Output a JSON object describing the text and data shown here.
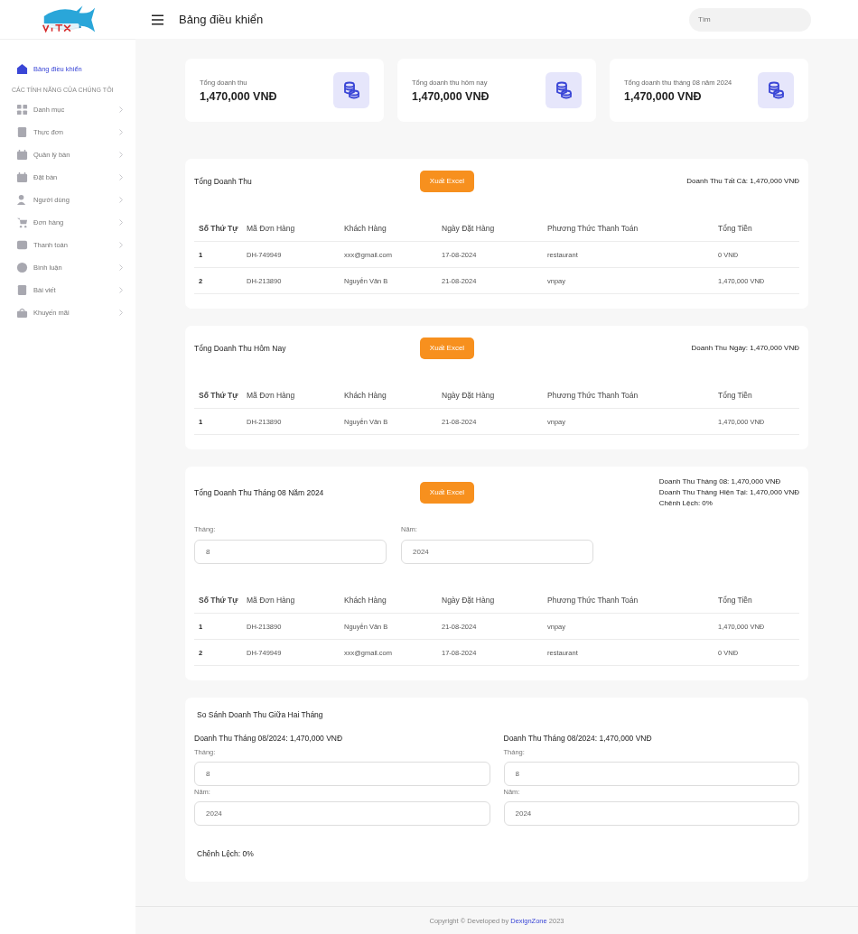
{
  "header": {
    "title": "Bảng điều khiển",
    "search": {
      "placeholder": "Tìm"
    }
  },
  "sidebar": {
    "items": [
      {
        "label": "Bảng điều khiển",
        "selected": true
      }
    ],
    "section_label": "CÁC TÍNH NĂNG CỦA CHÚNG TÔI",
    "features": [
      {
        "label": "Danh mục",
        "selected": false
      },
      {
        "label": "Thực đơn",
        "selected": false
      },
      {
        "label": "Quản lý bàn",
        "selected": false
      },
      {
        "label": "Đặt bàn",
        "selected": false
      },
      {
        "label": "Người dùng",
        "selected": false
      },
      {
        "label": "Đơn hàng",
        "selected": false
      },
      {
        "label": "Thanh toán",
        "selected": false
      },
      {
        "label": "Bình luận",
        "selected": false
      },
      {
        "label": "Bài viết",
        "selected": false
      },
      {
        "label": "Khuyến mãi",
        "selected": false
      }
    ]
  },
  "stats": [
    {
      "label": "Tổng doanh thu",
      "value": "1,470,000 VNĐ"
    },
    {
      "label": "Tổng doanh thu hôm nay",
      "value": "1,470,000 VNĐ"
    },
    {
      "label": "Tổng doanh thu tháng 08 năm 2024",
      "value": "1,470,000 VNĐ"
    }
  ],
  "sections": [
    {
      "title": "Tổng Doanh Thu",
      "button": "Xuất Excel",
      "summary": [
        "Doanh Thu Tất Cả: 1,470,000 VNĐ"
      ],
      "columns": [
        "Số Thứ Tự",
        "Mã Đơn Hàng",
        "Khách Hàng",
        "Ngày Đặt Hàng",
        "Phương Thức Thanh Toán",
        "Tổng Tiền"
      ],
      "rows": [
        [
          "1",
          "DH-749949",
          "xxx@gmail.com",
          "17-08-2024",
          "restaurant",
          "0 VNĐ"
        ],
        [
          "2",
          "DH-213890",
          "Nguyễn Văn B",
          "21-08-2024",
          "vnpay",
          "1,470,000 VNĐ"
        ]
      ]
    },
    {
      "title": "Tổng Doanh Thu Hôm Nay",
      "button": "Xuất Excel",
      "summary": [
        "Doanh Thu Ngày: 1,470,000 VNĐ"
      ],
      "columns": [
        "Số Thứ Tự",
        "Mã Đơn Hàng",
        "Khách Hàng",
        "Ngày Đặt Hàng",
        "Phương Thức Thanh Toán",
        "Tổng Tiền"
      ],
      "rows": [
        [
          "1",
          "DH-213890",
          "Nguyễn Văn B",
          "21-08-2024",
          "vnpay",
          "1,470,000 VNĐ"
        ]
      ]
    },
    {
      "title": "Tổng Doanh Thu Tháng 08 Năm 2024",
      "button": "Xuất Excel",
      "summary": [
        "Doanh Thu Tháng 08: 1,470,000 VNĐ",
        "Doanh Thu Tháng Hiện Tại: 1,470,000 VNĐ",
        "Chênh Lệch: 0%"
      ],
      "filters": [
        {
          "label": "Tháng:",
          "value": "8"
        },
        {
          "label": "Năm:",
          "value": "2024"
        }
      ],
      "columns": [
        "Số Thứ Tự",
        "Mã Đơn Hàng",
        "Khách Hàng",
        "Ngày Đặt Hàng",
        "Phương Thức Thanh Toán",
        "Tổng Tiền"
      ],
      "rows": [
        [
          "1",
          "DH-213890",
          "Nguyễn Văn B",
          "21-08-2024",
          "vnpay",
          "1,470,000 VNĐ"
        ],
        [
          "2",
          "DH-749949",
          "xxx@gmail.com",
          "17-08-2024",
          "restaurant",
          "0 VNĐ"
        ]
      ]
    }
  ],
  "comparison": {
    "title": "So Sánh Doanh Thu Giữa Hai Tháng",
    "months": [
      {
        "heading": "Doanh Thu Tháng 08/2024: 1,470,000 VNĐ",
        "fields": [
          {
            "label": "Tháng:",
            "value": "8"
          },
          {
            "label": "Năm:",
            "value": "2024"
          }
        ]
      },
      {
        "heading": "Doanh Thu Tháng 08/2024: 1,470,000 VNĐ",
        "fields": [
          {
            "label": "Tháng:",
            "value": "8"
          },
          {
            "label": "Năm:",
            "value": "2024"
          }
        ]
      }
    ],
    "difference": "Chênh Lệch: 0%"
  },
  "footer": {
    "text": "Copyright © Developed by",
    "link": "DexignZone",
    "year": "2023"
  }
}
